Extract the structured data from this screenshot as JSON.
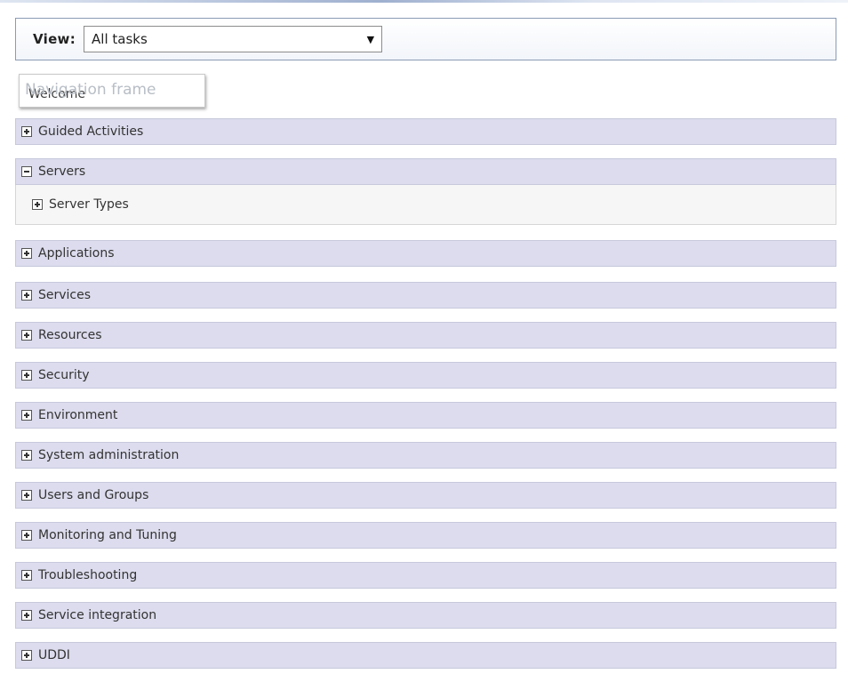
{
  "view": {
    "label": "View:",
    "selected": "All tasks",
    "arrow_icon": "dropdown-arrow-icon"
  },
  "tooltip": {
    "text": "Navigation frame",
    "covered_item": "Welcome"
  },
  "nav": {
    "items": [
      {
        "label": "Guided Activities",
        "expanded": false
      },
      {
        "label": "Servers",
        "expanded": true,
        "children": [
          {
            "label": "Server Types",
            "expanded": false
          }
        ]
      },
      {
        "label": "Applications",
        "expanded": false
      },
      {
        "label": "Services",
        "expanded": false
      },
      {
        "label": "Resources",
        "expanded": false
      },
      {
        "label": "Security",
        "expanded": false
      },
      {
        "label": "Environment",
        "expanded": false
      },
      {
        "label": "System administration",
        "expanded": false
      },
      {
        "label": "Users and Groups",
        "expanded": false
      },
      {
        "label": "Monitoring and Tuning",
        "expanded": false
      },
      {
        "label": "Troubleshooting",
        "expanded": false
      },
      {
        "label": "Service integration",
        "expanded": false
      },
      {
        "label": "UDDI",
        "expanded": false
      }
    ]
  },
  "colors": {
    "item_background": "#dcdcee",
    "sub_background": "#f6f6f6",
    "view_border": "#8a9bb4"
  }
}
